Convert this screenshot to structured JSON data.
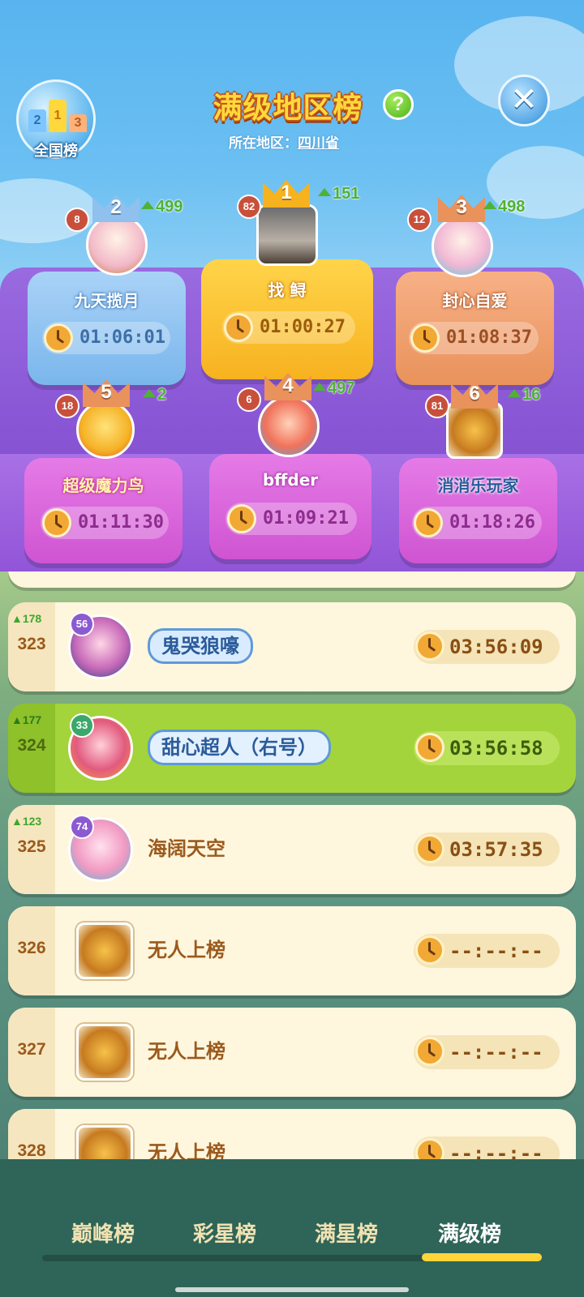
{
  "header": {
    "national_label": "全国榜",
    "national_podium": [
      "2",
      "1",
      "3"
    ],
    "title": "满级地区榜",
    "help_symbol": "?",
    "region_label": "所在地区：",
    "region_value": "四川省",
    "close_symbol": "✕"
  },
  "podium": [
    {
      "rank": "1",
      "name": "找 鲟",
      "time": "01:00:27",
      "level": "82",
      "rise": "151",
      "crown": "gold"
    },
    {
      "rank": "2",
      "name": "九天揽月",
      "time": "01:06:01",
      "level": "8",
      "rise": "499",
      "crown": "silver"
    },
    {
      "rank": "3",
      "name": "封心自爱",
      "time": "01:08:37",
      "level": "12",
      "rise": "498",
      "crown": "bronze"
    },
    {
      "rank": "4",
      "name": "bffder",
      "time": "01:09:21",
      "level": "6",
      "rise": "497",
      "crown": "bronze"
    },
    {
      "rank": "5",
      "name": "超级魔力鸟",
      "time": "01:11:30",
      "level": "18",
      "rise": "2",
      "crown": "bronze"
    },
    {
      "rank": "6",
      "name": "消消乐玩家",
      "time": "01:18:26",
      "level": "81",
      "rise": "16",
      "crown": "bronze"
    }
  ],
  "list": [
    {
      "rank": "323",
      "rise": "178",
      "level": "56",
      "name": "鬼哭狼嚎",
      "time": "03:56:09",
      "me": false
    },
    {
      "rank": "324",
      "rise": "177",
      "level": "33",
      "name": "甜心超人（右号）",
      "time": "03:56:58",
      "me": true
    },
    {
      "rank": "325",
      "rise": "123",
      "level": "74",
      "name": "海阔天空",
      "time": "03:57:35",
      "me": false
    },
    {
      "rank": "326",
      "rise": "",
      "level": "",
      "name": "无人上榜",
      "time": "--:--:--",
      "me": false
    },
    {
      "rank": "327",
      "rise": "",
      "level": "",
      "name": "无人上榜",
      "time": "--:--:--",
      "me": false
    },
    {
      "rank": "328",
      "rise": "",
      "level": "",
      "name": "无人上榜",
      "time": "--:--:--",
      "me": false
    }
  ],
  "tabs": [
    {
      "label": "巅峰榜",
      "active": false
    },
    {
      "label": "彩星榜",
      "active": false
    },
    {
      "label": "满星榜",
      "active": false
    },
    {
      "label": "满级榜",
      "active": true
    }
  ],
  "icons": {
    "national": "podium-icon",
    "help": "question-icon",
    "close": "close-icon",
    "clock": "clock-icon",
    "rise": "arrow-up-icon",
    "crown": "crown-icon"
  },
  "colors": {
    "gold": "#f7b21f",
    "silver": "#8fc0ee",
    "bronze": "#e9925b",
    "purple": "#d25fd8",
    "highlight": "#a3d43b"
  }
}
